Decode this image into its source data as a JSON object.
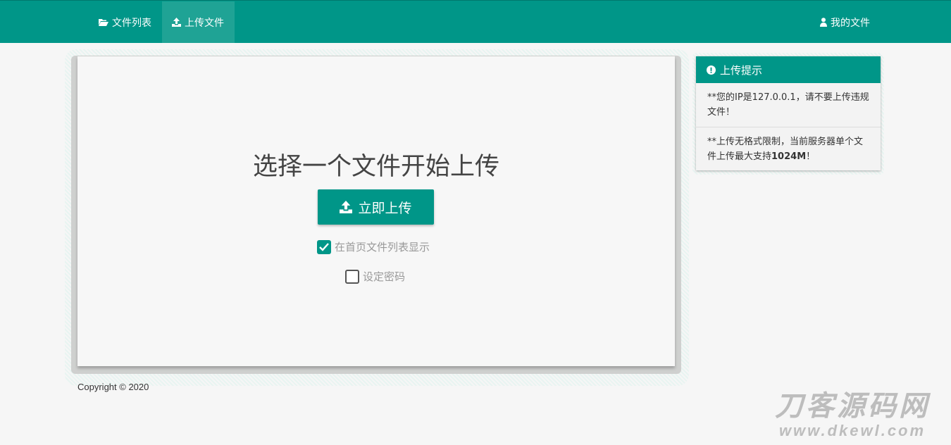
{
  "nav": {
    "files_label": "文件列表",
    "upload_label": "上传文件",
    "my_files_label": "我的文件"
  },
  "upload": {
    "title": "选择一个文件开始上传",
    "button_label": "立即上传",
    "show_on_home_label": "在首页文件列表显示",
    "show_on_home_checked": true,
    "set_password_label": "设定密码",
    "set_password_checked": false
  },
  "tips": {
    "title": "上传提示",
    "ip_prefix": "**您的IP是127.0.0.1，请不要上传违规文件！",
    "limit_prefix": "**上传无格式限制，当前服务器单个文件上传最大支持",
    "limit_value": "1024M",
    "limit_suffix": "！"
  },
  "footer": {
    "copyright": "Copyright © 2020"
  },
  "watermark": {
    "name": "刀客源码网",
    "url": "www.dkewl.com"
  },
  "colors": {
    "accent": "#009688",
    "accent_active": "#1fa395"
  },
  "icons": {
    "files": "folder-open-icon",
    "upload": "upload-icon",
    "user": "user-icon",
    "alert": "exclamation-circle-icon",
    "check": "check-icon"
  }
}
